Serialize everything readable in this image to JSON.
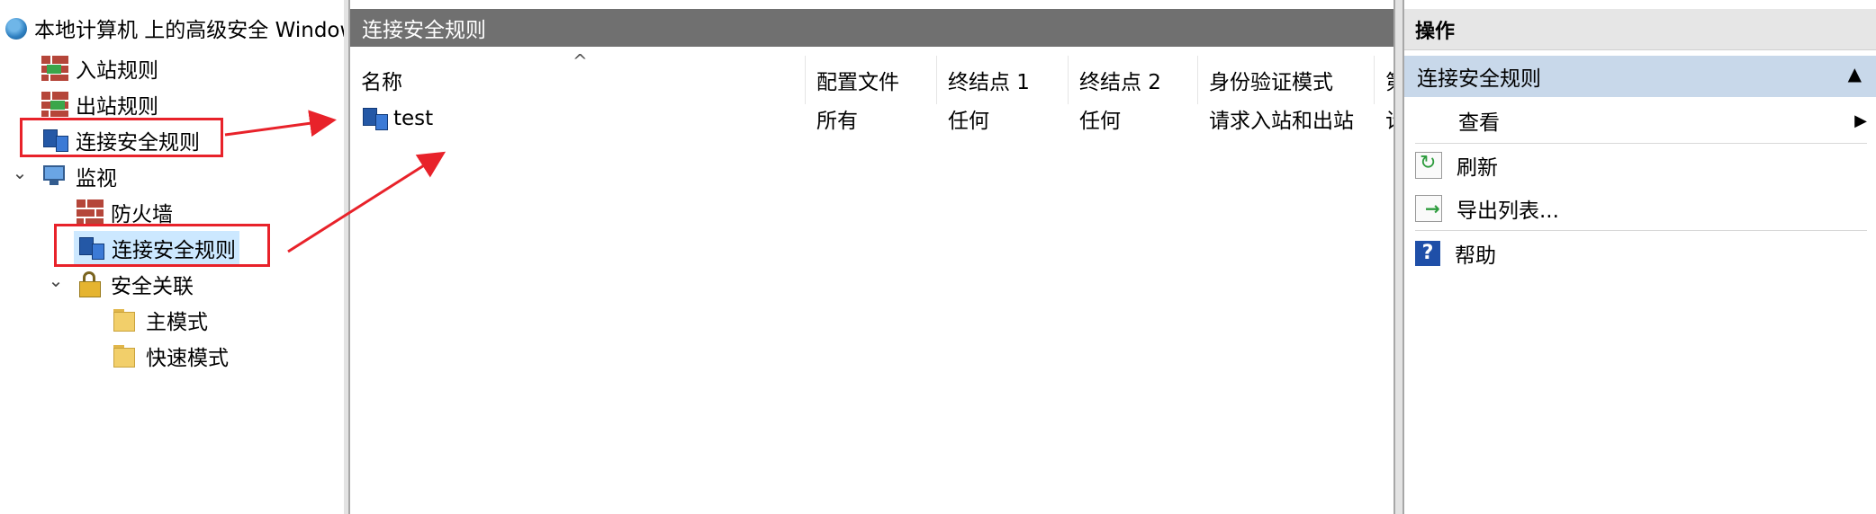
{
  "tree": {
    "root": "本地计算机 上的高级安全 Windows Defender 防火墙",
    "items": [
      {
        "label": "入站规则"
      },
      {
        "label": "出站规则"
      },
      {
        "label": "连接安全规则"
      },
      {
        "label": "监视"
      },
      {
        "label": "防火墙"
      },
      {
        "label": "连接安全规则"
      },
      {
        "label": "安全关联"
      },
      {
        "label": "主模式"
      },
      {
        "label": "快速模式"
      }
    ]
  },
  "center": {
    "title": "连接安全规则",
    "sort_glyph": "^",
    "columns": [
      "名称",
      "配置文件",
      "终结点 1",
      "终结点 2",
      "身份验证模式",
      "第"
    ],
    "rows": [
      {
        "name": "test",
        "profile": "所有",
        "endpoint1": "任何",
        "endpoint2": "任何",
        "auth": "请求入站和出站",
        "extra": "计"
      }
    ]
  },
  "actions": {
    "title": "操作",
    "section": "连接安全规则",
    "items": [
      {
        "label": "查看"
      },
      {
        "label": "刷新"
      },
      {
        "label": "导出列表..."
      },
      {
        "label": "帮助"
      }
    ]
  },
  "colors": {
    "annotation": "#e8222a",
    "header_bg": "#707070",
    "section_bg": "#c8d8ea",
    "selected_bg": "#cce8ff"
  }
}
